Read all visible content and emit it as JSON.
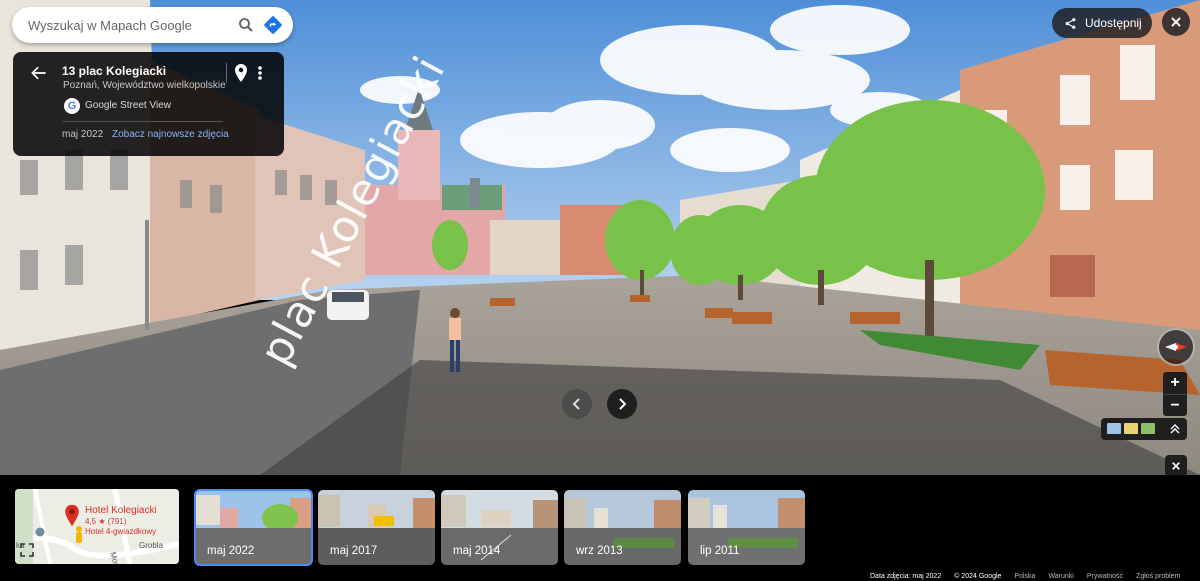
{
  "search": {
    "placeholder": "Wyszukaj w Mapach Google"
  },
  "info_card": {
    "title": "13 plac Kolegiacki",
    "subtitle": "Poznań, Województwo wielkopolskie",
    "source_badge": "G",
    "source": "Google Street View",
    "date": "maj 2022",
    "newest_link": "Zobacz najnowsze zdjęcia"
  },
  "top_right": {
    "share_label": "Udostępnij"
  },
  "street_label": "plac Kolegiacki",
  "minimap": {
    "place_name": "Hotel Kolegiacki",
    "rating": "4,5 ★ (791)",
    "type": "Hotel 4-gwiazdkowy",
    "streets": [
      "Grobla",
      "Most",
      "ka"
    ]
  },
  "timeline": [
    {
      "label": "maj 2022",
      "selected": true
    },
    {
      "label": "maj 2017",
      "selected": false
    },
    {
      "label": "maj 2014",
      "selected": false
    },
    {
      "label": "wrz 2013",
      "selected": false
    },
    {
      "label": "lip 2011",
      "selected": false
    }
  ],
  "footer": {
    "date": "Data zdjęcia: maj 2022",
    "copyright": "© 2024 Google",
    "country": "Polska",
    "terms": "Warunki",
    "privacy": "Prywatność",
    "report": "Zgłoś problem"
  },
  "colors": {
    "accent": "#4a8cf0",
    "link": "#8ab4f8",
    "pin": "#d93025",
    "directions": "#1a73e8"
  },
  "icons": {
    "search": "search-icon",
    "directions": "directions-icon",
    "back": "back-arrow-icon",
    "pin": "location-pin-icon",
    "more": "more-vert-icon",
    "share": "share-icon",
    "close": "close-icon",
    "compass": "compass-icon",
    "expand": "fullscreen-icon",
    "prev": "chevron-left-icon",
    "next": "chevron-right-icon"
  }
}
